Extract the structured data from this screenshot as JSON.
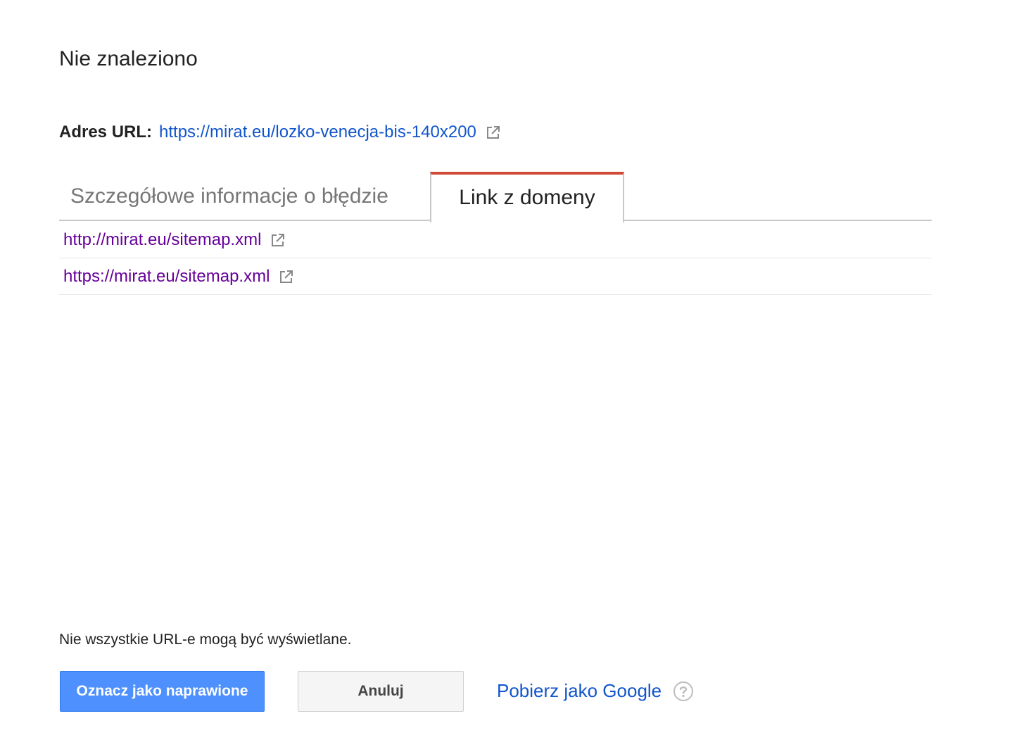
{
  "header": {
    "title": "Nie znaleziono"
  },
  "url": {
    "label": "Adres URL:",
    "value": "https://mirat.eu/lozko-venecja-bis-140x200",
    "icon": "external-link-icon"
  },
  "tabs": [
    {
      "label": "Szczegółowe informacje o błędzie",
      "active": false
    },
    {
      "label": "Link z domeny",
      "active": true
    }
  ],
  "links": [
    {
      "text": "http://mirat.eu/sitemap.xml",
      "icon": "external-link-icon"
    },
    {
      "text": "https://mirat.eu/sitemap.xml",
      "icon": "external-link-icon"
    }
  ],
  "footer": {
    "note": "Nie wszystkie URL-e mogą być wyświetlane.",
    "primary_button": "Oznacz jako naprawione",
    "cancel_button": "Anuluj",
    "fetch_link": "Pobierz jako Google",
    "help_icon": "help-circle-icon"
  },
  "colors": {
    "link": "#1155cc",
    "visited_link": "#660099",
    "active_tab_accent": "#d14836",
    "primary_button": "#4d90fe"
  }
}
